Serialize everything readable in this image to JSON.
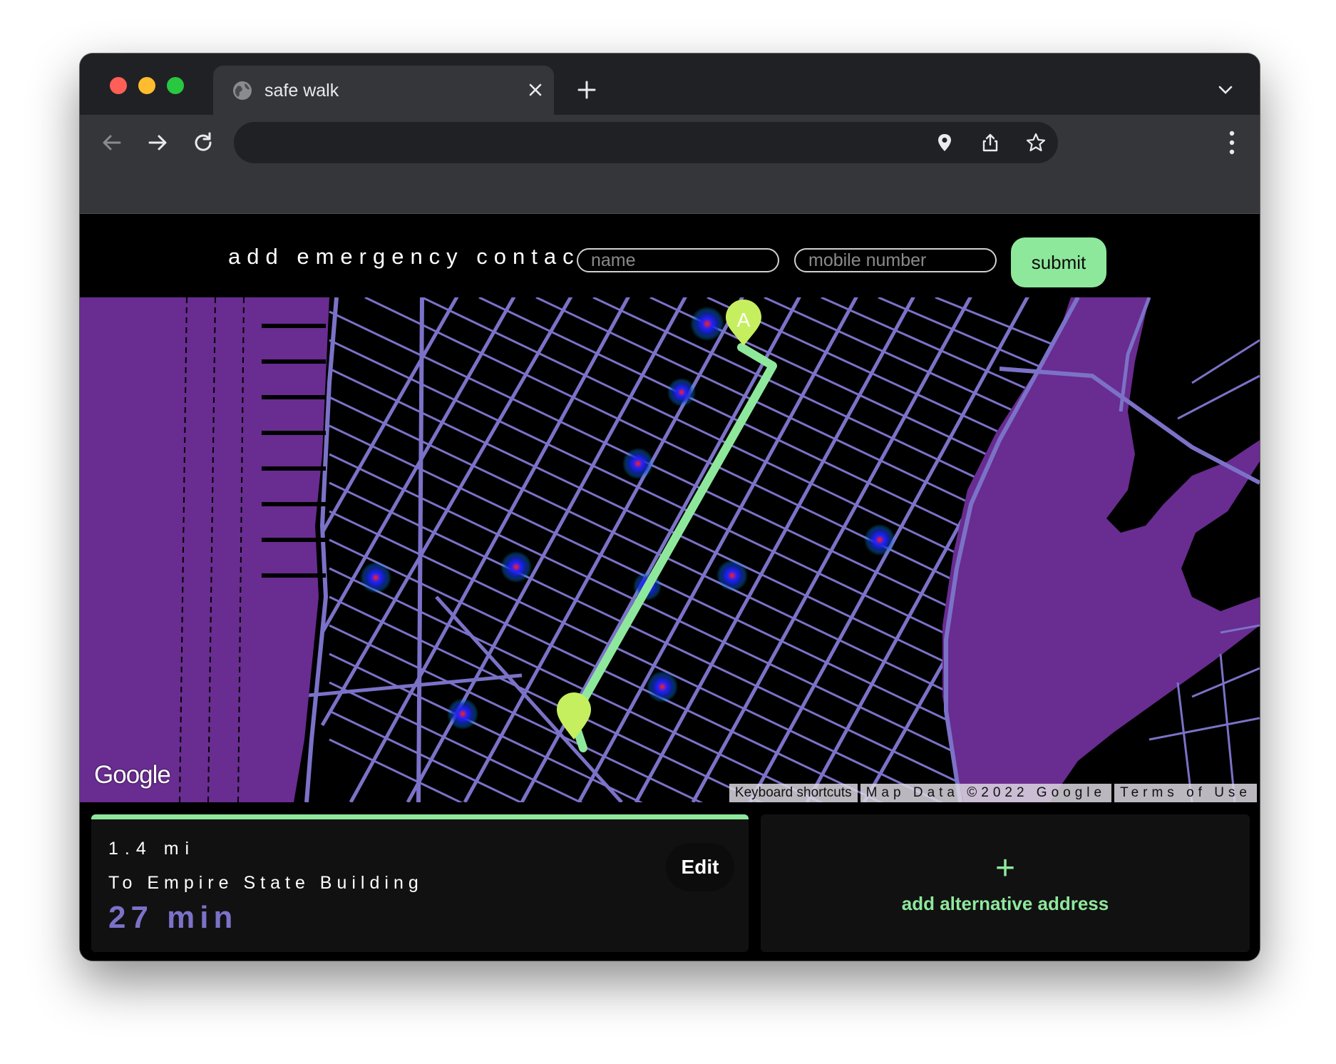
{
  "browser": {
    "tab_title": "safe walk",
    "address": ""
  },
  "contact_form": {
    "title": "add emergency contact",
    "name_placeholder": "name",
    "phone_placeholder": "mobile number",
    "submit_label": "submit"
  },
  "map": {
    "logo": "Google",
    "start_marker_label": "A",
    "attribution": {
      "shortcuts": "Keyboard shortcuts",
      "data": "Map Data ©2022 Google",
      "terms": "Terms of Use"
    },
    "colors": {
      "water": "#692c90",
      "land": "#000000",
      "roads": "#7b72c8",
      "route": "#8ee89c",
      "marker": "#c6ef5f"
    }
  },
  "route": {
    "distance": "1.4 mi",
    "destination": "To Empire State Building",
    "duration": "27 min",
    "edit_label": "Edit"
  },
  "alternative": {
    "plus": "+",
    "label": "add alternative address"
  }
}
